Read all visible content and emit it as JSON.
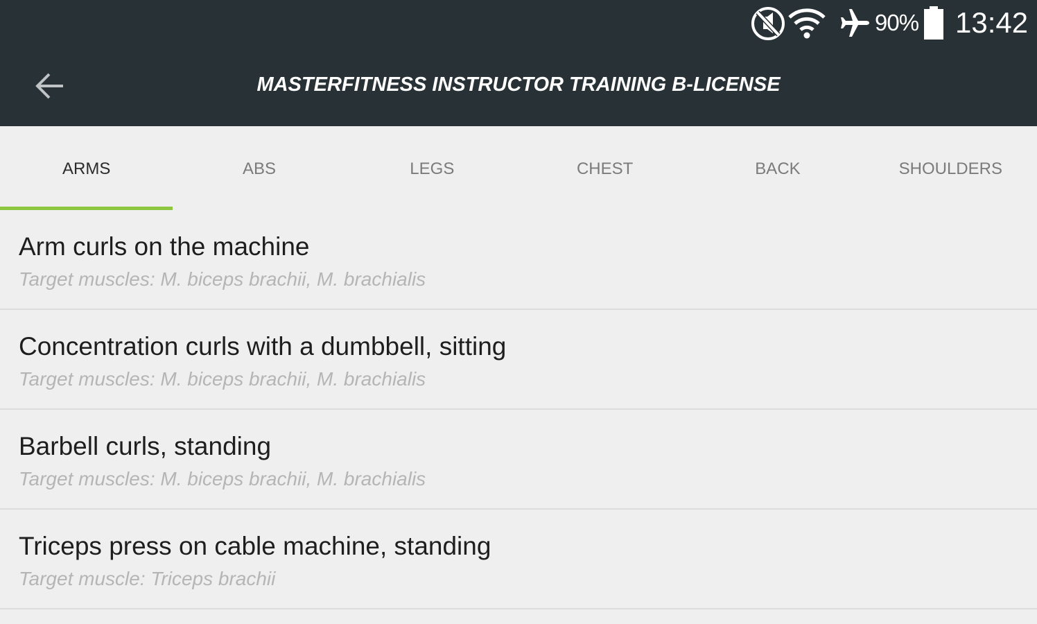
{
  "status_bar": {
    "battery_percent": "90%",
    "time": "13:42",
    "icons": [
      "mute-icon",
      "wifi-icon",
      "airplane-icon",
      "battery-icon"
    ]
  },
  "toolbar": {
    "title": "MASTERFITNESS INSTRUCTOR TRAINING B-LICENSE",
    "back_icon": "arrow-left-icon"
  },
  "tabs": [
    {
      "label": "ARMS"
    },
    {
      "label": "ABS"
    },
    {
      "label": "LEGS"
    },
    {
      "label": "CHEST"
    },
    {
      "label": "BACK"
    },
    {
      "label": "SHOULDERS"
    }
  ],
  "active_tab": "ARMS",
  "exercises": [
    {
      "title": "Arm curls on the machine",
      "target": "Target muscles: M. biceps brachii, M. brachialis"
    },
    {
      "title": "Concentration curls with a dumbbell, sitting",
      "target": "Target muscles: M. biceps brachii, M. brachialis"
    },
    {
      "title": "Barbell curls, standing",
      "target": "Target muscles: M. biceps brachii, M. brachialis"
    },
    {
      "title": "Triceps press on cable machine, standing",
      "target": "Target muscle: Triceps brachii"
    }
  ],
  "colors": {
    "top_bar": "#283135",
    "background": "#efefef",
    "accent": "#8dc63f",
    "divider": "#dcdcdc"
  }
}
